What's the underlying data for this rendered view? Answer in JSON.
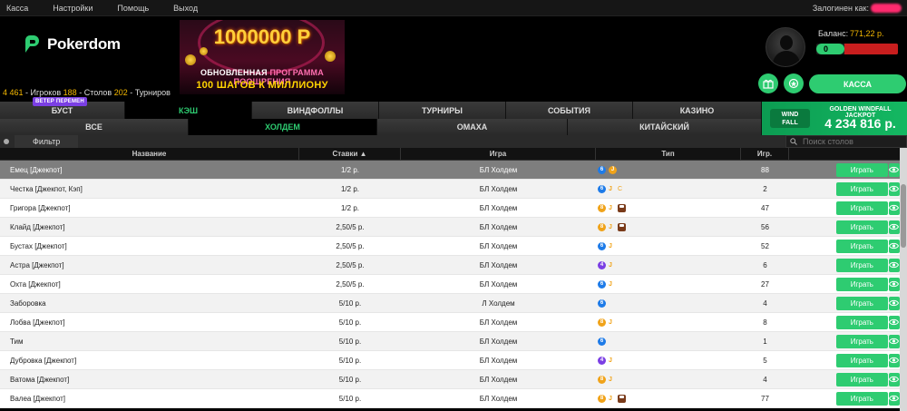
{
  "menu": {
    "items": [
      "Касса",
      "Настройки",
      "Помощь",
      "Выход"
    ],
    "logged_in_label": "Залогинен как:"
  },
  "brand": {
    "name": "Pokerdom",
    "color": "#2ecc71"
  },
  "stats": {
    "players": "4 461",
    "players_label": "- Игроков",
    "tables": "188",
    "tables_label": "- Столов",
    "tournaments": "202",
    "tournaments_label": "- Турниров"
  },
  "banner": {
    "amount": "1000000 Р",
    "line1_a": "ОБНОВЛЕННАЯ",
    "line1_b": "ПРОГРАММА ПООЩРЕНИЯ",
    "line2": "100 ШАГОВ К МИЛЛИОНУ"
  },
  "account": {
    "balance_label": "Баланс:",
    "balance_value": "771,22 р.",
    "progress_text": "0",
    "kassa_label": "КАССА"
  },
  "tabs_primary": [
    {
      "label": "БУСТ",
      "active": false
    },
    {
      "label": "КЭШ",
      "active": true
    },
    {
      "label": "ВИНДФОЛЛЫ",
      "active": false
    },
    {
      "label": "ТУРНИРЫ",
      "active": false
    },
    {
      "label": "СОБЫТИЯ",
      "active": false
    },
    {
      "label": "КАЗИНО",
      "active": false
    }
  ],
  "new_tag": "ВЕТЕР ПЕРЕМЕН",
  "tabs_secondary": [
    {
      "label": "ВСЕ",
      "active": false
    },
    {
      "label": "ХОЛДЕМ",
      "active": true
    },
    {
      "label": "ОМАХА",
      "active": false
    },
    {
      "label": "КИТАЙСКИЙ",
      "active": false
    }
  ],
  "jackpot": {
    "logo_line1": "WIND",
    "logo_line2": "FALL",
    "title": "GOLDEN WINDFALL JACKPOT",
    "value": "4 234 816 р."
  },
  "filter": {
    "label": "Фильтр",
    "search_placeholder": "Поиск столов"
  },
  "table": {
    "headers": [
      "Название",
      "Ставки ▲",
      "Игра",
      "Тип",
      "Игр.",
      ""
    ],
    "play_label": "Играть",
    "rows": [
      {
        "name": "Емец [Джекпот]",
        "stake": "1/2 р.",
        "game": "БЛ Холдем",
        "type": [
          "6",
          "J-on"
        ],
        "players": "88"
      },
      {
        "name": "Честка [Джекпот, Кэп]",
        "stake": "1/2 р.",
        "game": "БЛ Холдем",
        "type": [
          "6",
          "J",
          "C"
        ],
        "players": "2"
      },
      {
        "name": "Григора [Джекпот]",
        "stake": "1/2 р.",
        "game": "БЛ Холдем",
        "type": [
          "8",
          "J",
          "cup"
        ],
        "players": "47"
      },
      {
        "name": "Клайд [Джекпот]",
        "stake": "2,50/5 р.",
        "game": "БЛ Холдем",
        "type": [
          "8",
          "J",
          "cup"
        ],
        "players": "56"
      },
      {
        "name": "Бустах [Джекпот]",
        "stake": "2,50/5 р.",
        "game": "БЛ Холдем",
        "type": [
          "6",
          "J"
        ],
        "players": "52"
      },
      {
        "name": "Астра [Джекпот]",
        "stake": "2,50/5 р.",
        "game": "БЛ Холдем",
        "type": [
          "4",
          "J"
        ],
        "players": "6"
      },
      {
        "name": "Охта [Джекпот]",
        "stake": "2,50/5 р.",
        "game": "БЛ Холдем",
        "type": [
          "6",
          "J"
        ],
        "players": "27"
      },
      {
        "name": "Заборовка",
        "stake": "5/10 р.",
        "game": "Л Холдем",
        "type": [
          "6"
        ],
        "players": "4"
      },
      {
        "name": "Лобва [Джекпот]",
        "stake": "5/10 р.",
        "game": "БЛ Холдем",
        "type": [
          "8",
          "J"
        ],
        "players": "8"
      },
      {
        "name": "Тим",
        "stake": "5/10 р.",
        "game": "БЛ Холдем",
        "type": [
          "6"
        ],
        "players": "1"
      },
      {
        "name": "Дубровка [Джекпот]",
        "stake": "5/10 р.",
        "game": "БЛ Холдем",
        "type": [
          "4",
          "J"
        ],
        "players": "5"
      },
      {
        "name": "Ватома [Джекпот]",
        "stake": "5/10 р.",
        "game": "БЛ Холдем",
        "type": [
          "8",
          "J"
        ],
        "players": "4"
      },
      {
        "name": "Валеа [Джекпот]",
        "stake": "5/10 р.",
        "game": "БЛ Холдем",
        "type": [
          "8",
          "J",
          "cup"
        ],
        "players": "77"
      }
    ]
  }
}
